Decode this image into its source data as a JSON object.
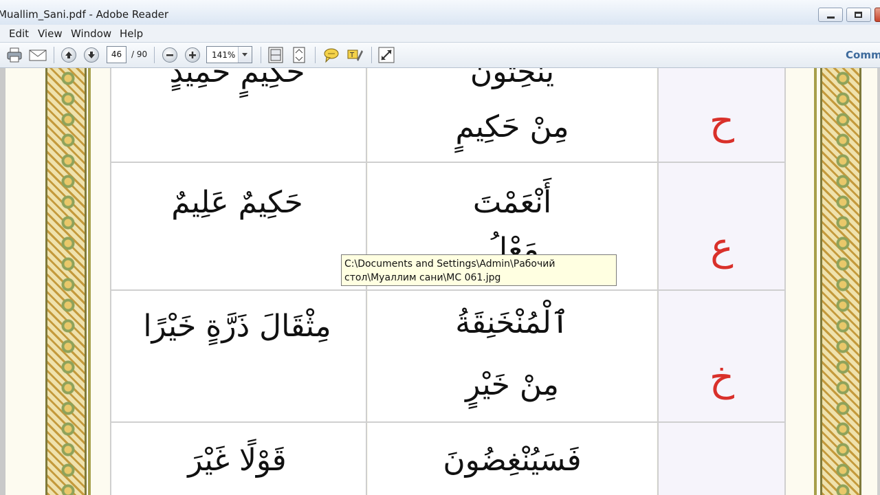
{
  "window": {
    "title": "Muallim_Sani.pdf - Adobe Reader"
  },
  "menu": [
    "Edit",
    "View",
    "Window",
    "Help"
  ],
  "toolbar": {
    "page_current": "46",
    "page_total": "/ 90",
    "zoom": "141%",
    "comment": "Comment"
  },
  "tooltip": {
    "line1": "C:\\Documents and Settings\\Admin\\Рабочий",
    "line2": "стол\\Муаллим сани\\МС 061.jpg"
  },
  "rows": [
    {
      "letter": "ح",
      "middle": [
        "يَنْحِتُونَ",
        "مِنْ حَكِيمٍ"
      ],
      "left": "حَكِيمٍ حَمِيدٍ"
    },
    {
      "letter": "ع",
      "middle": [
        "أَنْعَمْتَ",
        "مَعْلُ"
      ],
      "left": "حَكِيمٌ عَلِيمٌ"
    },
    {
      "letter": "خ",
      "middle": [
        "ٱلْمُنْخَنِقَةُ",
        "مِنْ خَيْرٍ"
      ],
      "left": "مِثْقَالَ ذَرَّةٍ خَيْرًا"
    },
    {
      "letter": "",
      "middle": [
        "فَسَيُنْغِضُونَ"
      ],
      "left": "قَوْلًا غَيْرَ"
    }
  ]
}
